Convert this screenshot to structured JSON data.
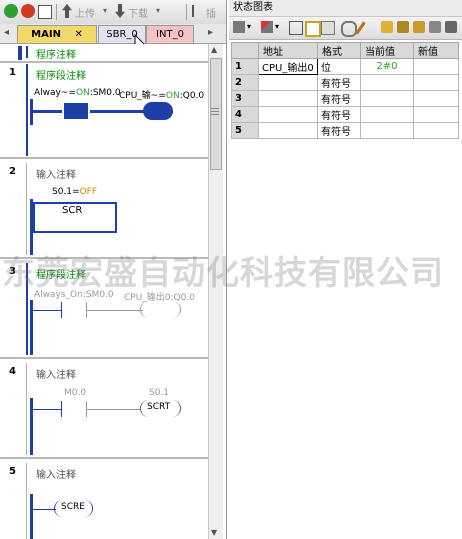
{
  "toolbar": {
    "upload_label": "上传",
    "download_label": "下载",
    "insert_label": "插"
  },
  "tabs": [
    {
      "label": "MAIN"
    },
    {
      "label": "SBR_0"
    },
    {
      "label": "INT_0"
    }
  ],
  "networks": [
    {
      "number": "1",
      "comment": "程序段注释",
      "contact_label_a": "Alway~=",
      "contact_state_a": "ON",
      "contact_addr_a": ":SM0.0",
      "coil_label_a": "CPU_输~=",
      "coil_state_a": "ON",
      "coil_addr_a": ":Q0.0"
    },
    {
      "number": "2",
      "comment": "输入注释",
      "var_label": "S0.1",
      "var_eq": "=",
      "var_state": "OFF",
      "box_label": "SCR"
    },
    {
      "number": "3",
      "comment": "程序段注释",
      "contact_label": "Always_On:SM0.0",
      "coil_label": "CPU_输出0:Q0.0"
    },
    {
      "number": "4",
      "comment": "输入注释",
      "contact_label": "M0.0",
      "coil_top": "S0.1",
      "coil_text": "SCRT"
    },
    {
      "number": "5",
      "comment": "输入注释",
      "coil_text": "SCRE"
    }
  ],
  "top_comment": "程序注释",
  "status_chart": {
    "title": "状态图表",
    "headers": [
      "",
      "地址",
      "格式",
      "当前值",
      "新值"
    ],
    "rows": [
      {
        "num": "1",
        "address": "CPU_输出0",
        "format": "位",
        "current": "2#0",
        "new": ""
      },
      {
        "num": "2",
        "address": "",
        "format": "有符号",
        "current": "",
        "new": ""
      },
      {
        "num": "3",
        "address": "",
        "format": "有符号",
        "current": "",
        "new": ""
      },
      {
        "num": "4",
        "address": "",
        "format": "有符号",
        "current": "",
        "new": ""
      },
      {
        "num": "5",
        "address": "",
        "format": "有符号",
        "current": "",
        "new": ""
      }
    ]
  },
  "watermark": "东莞宏盛自动化科技有限公司",
  "colors": {
    "active_tab": "#f3d96b",
    "ladder_blue": "#1f3fa8",
    "on_green": "#2f9e2f",
    "off_orange": "#d08000"
  }
}
